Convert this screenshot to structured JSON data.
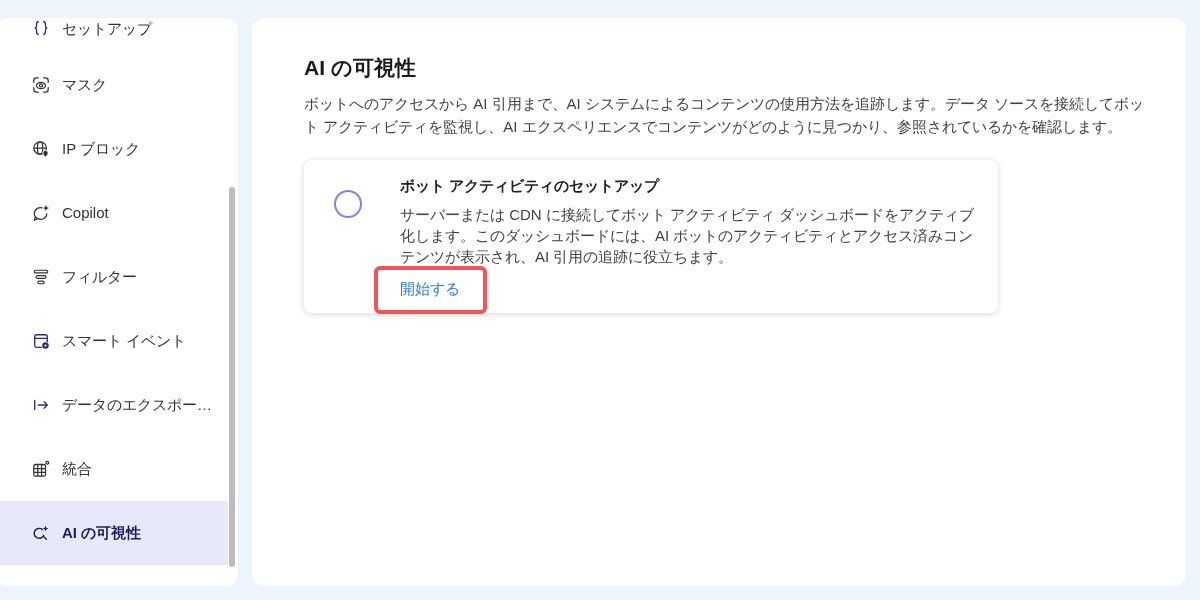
{
  "sidebar": {
    "items": [
      {
        "label": "セットアップ",
        "selected": false
      },
      {
        "label": "マスク",
        "selected": false
      },
      {
        "label": "IP ブロック",
        "selected": false
      },
      {
        "label": "Copilot",
        "selected": false
      },
      {
        "label": "フィルター",
        "selected": false
      },
      {
        "label": "スマート イベント",
        "selected": false
      },
      {
        "label": "データのエクスポー…",
        "selected": false
      },
      {
        "label": "統合",
        "selected": false
      },
      {
        "label": "AI の可視性",
        "selected": true
      }
    ]
  },
  "main": {
    "title": "AI の可視性",
    "description": "ボットへのアクセスから AI 引用まで、AI システムによるコンテンツの使用方法を追跡します。データ ソースを接続してボット アクティビティを監視し、AI エクスペリエンスでコンテンツがどのように見つかり、参照されているかを確認します。"
  },
  "setup_card": {
    "completed": false,
    "title": "ボット アクティビティのセットアップ",
    "description": "サーバーまたは CDN に接続してボット アクティビティ ダッシュボードをアクティブ化します。このダッシュボードには、AI ボットのアクティビティとアクセス済みコンテンツが表示され、AI 引用の追跡に役立ちます。",
    "action": {
      "label": "開始する",
      "highlighted": true
    }
  }
}
